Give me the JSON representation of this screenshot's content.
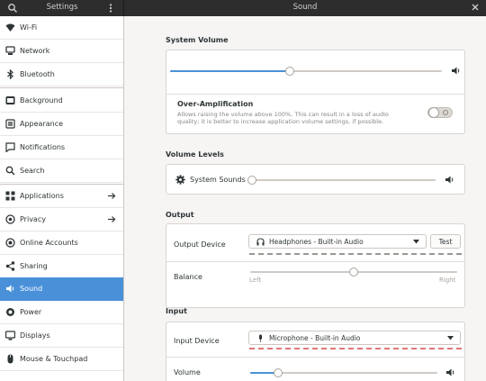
{
  "header": {
    "left_title": "Settings",
    "right_title": "Sound"
  },
  "sidebar": {
    "items": [
      {
        "label": "Wi-Fi",
        "icon": "wifi-icon"
      },
      {
        "label": "Network",
        "icon": "network-icon"
      },
      {
        "label": "Bluetooth",
        "icon": "bluetooth-icon"
      },
      {
        "label": "Background",
        "icon": "background-icon"
      },
      {
        "label": "Appearance",
        "icon": "appearance-icon"
      },
      {
        "label": "Notifications",
        "icon": "notifications-icon"
      },
      {
        "label": "Search",
        "icon": "search-icon"
      },
      {
        "label": "Applications",
        "icon": "applications-icon",
        "arrow": true
      },
      {
        "label": "Privacy",
        "icon": "privacy-icon",
        "arrow": true
      },
      {
        "label": "Online Accounts",
        "icon": "online-accounts-icon"
      },
      {
        "label": "Sharing",
        "icon": "sharing-icon"
      },
      {
        "label": "Sound",
        "icon": "sound-icon",
        "active": true
      },
      {
        "label": "Power",
        "icon": "power-icon"
      },
      {
        "label": "Displays",
        "icon": "displays-icon"
      },
      {
        "label": "Mouse & Touchpad",
        "icon": "mouse-icon"
      }
    ]
  },
  "system_volume": {
    "title": "System Volume",
    "level": 0.44,
    "over_amplification": {
      "title": "Over-Amplification",
      "description_line1": "Allows raising the volume above 100%. This can result in a loss of audio",
      "description_line2": "quality; it is better to increase application volume settings, if possible.",
      "enabled": false
    }
  },
  "volume_levels": {
    "title": "Volume Levels",
    "system_sounds_label": "System Sounds",
    "system_sounds_level": 0.0
  },
  "output": {
    "title": "Output",
    "device_label": "Output Device",
    "device_value": "Headphones - Built-in Audio",
    "test_label": "Test",
    "balance_label": "Balance",
    "balance_left": "Left",
    "balance_right": "Right",
    "balance_value": 0.5
  },
  "input": {
    "title": "Input",
    "device_label": "Input Device",
    "device_value": "Microphone - Built-in Audio",
    "volume_label": "Volume",
    "volume_level": 0.15
  },
  "colors": {
    "accent": "#4a90d9",
    "header_bg": "#2d2d2d"
  }
}
